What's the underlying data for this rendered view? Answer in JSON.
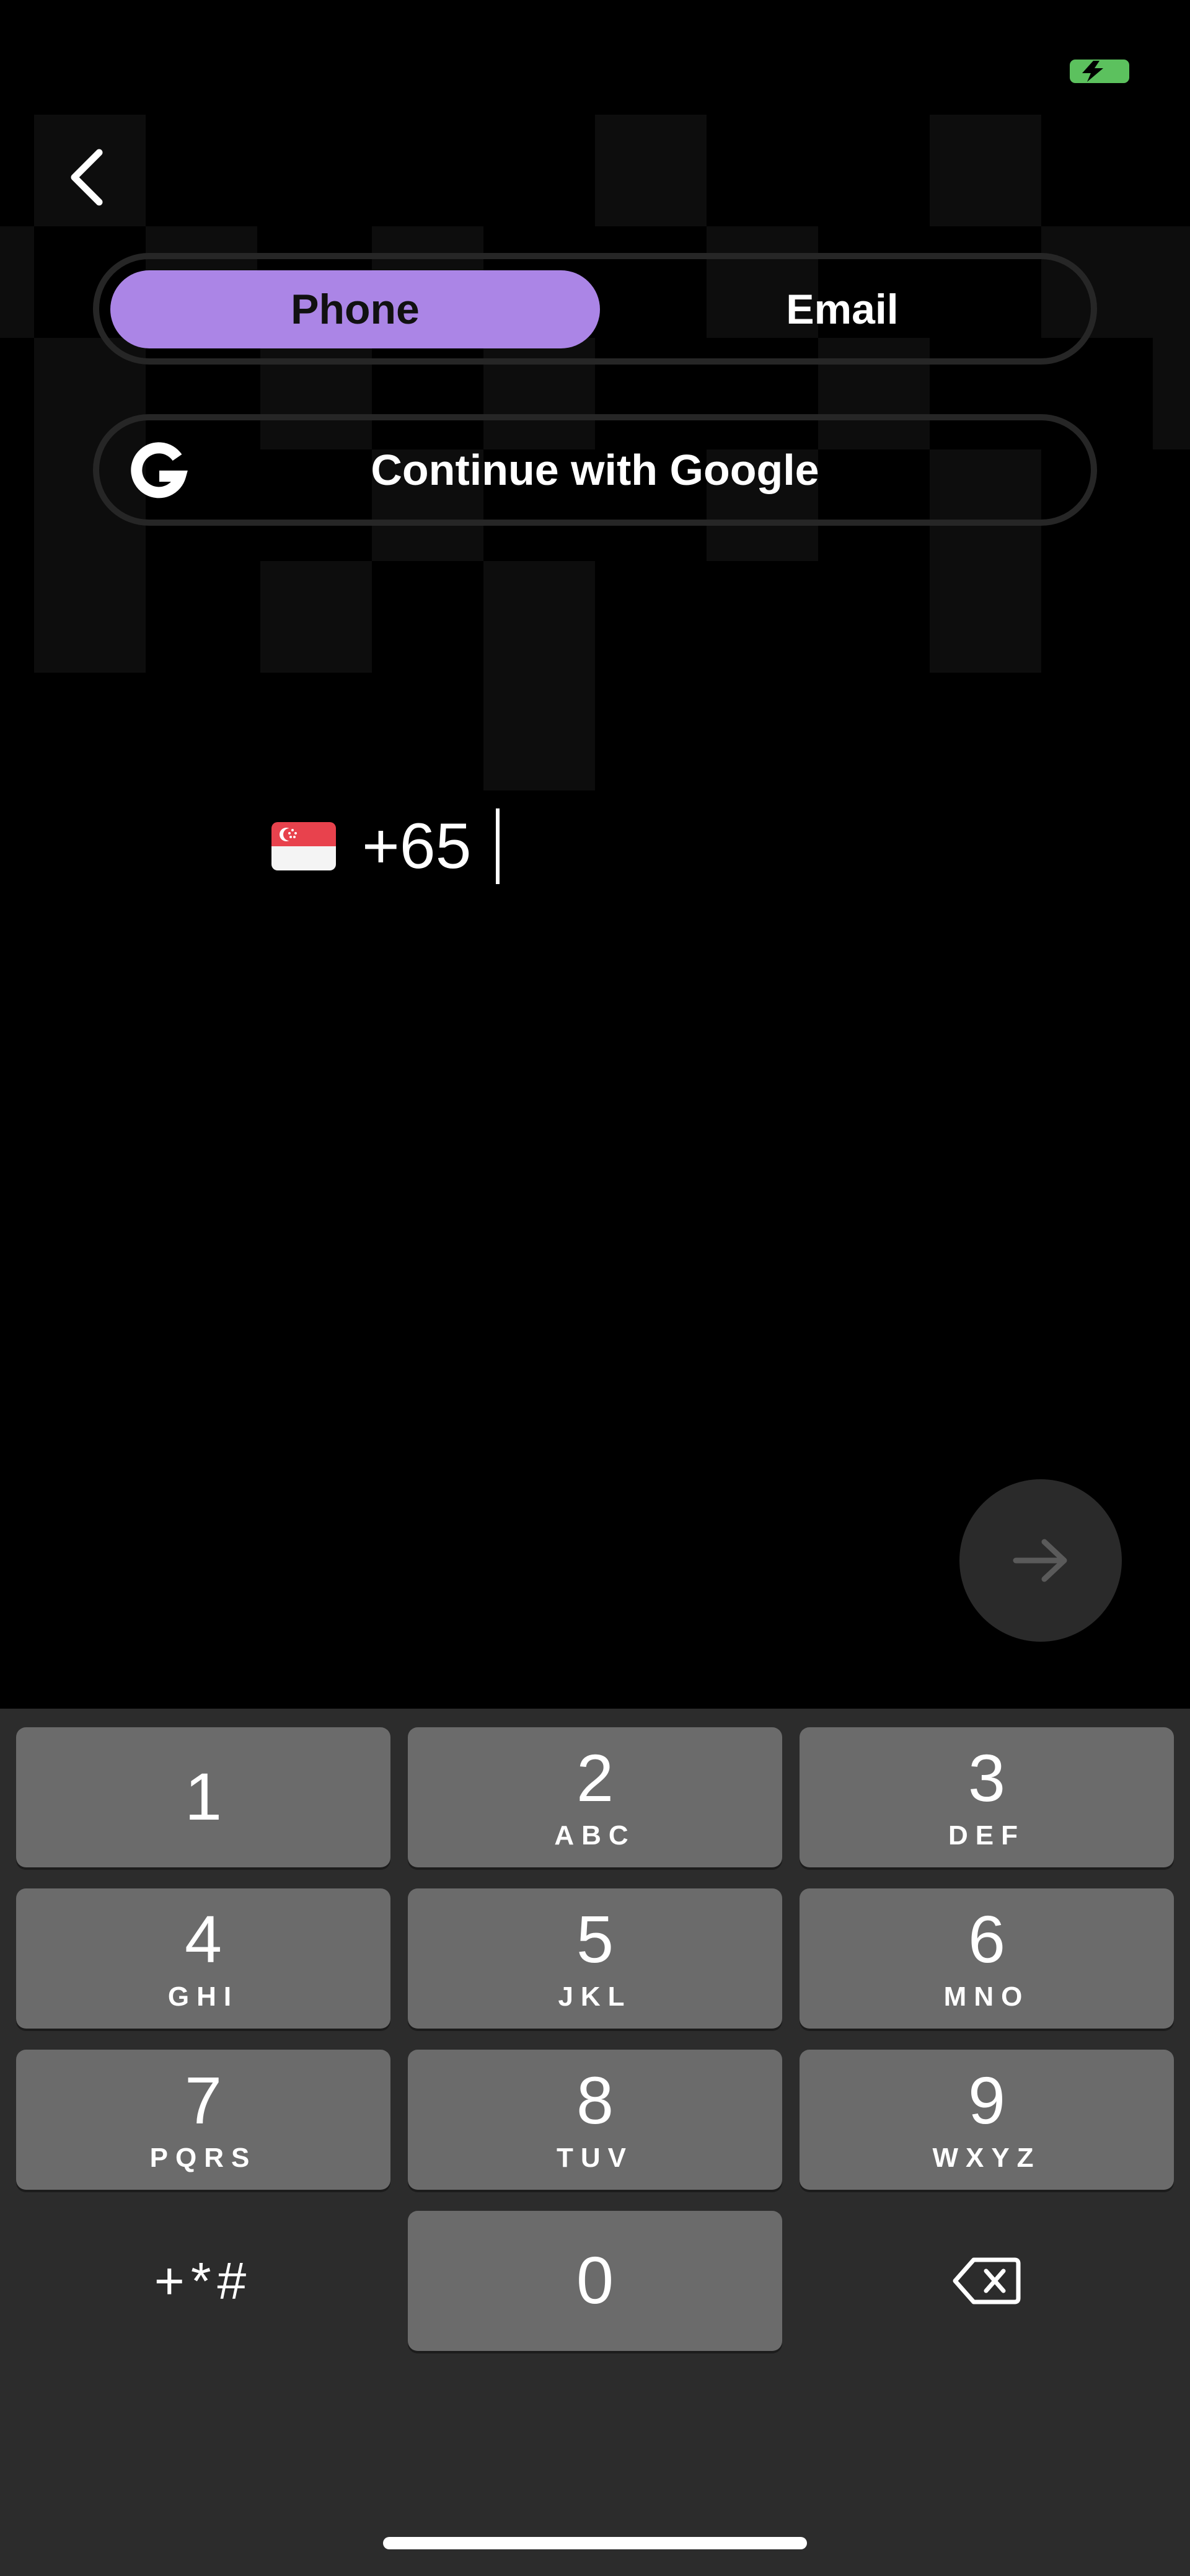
{
  "auth_tabs": {
    "phone": "Phone",
    "email": "Email",
    "selected": "Phone"
  },
  "google_button": {
    "label": "Continue with Google",
    "icon": "google-g-icon"
  },
  "phone": {
    "country": "Singapore",
    "flag_icon": "singapore-flag-icon",
    "value": "+65"
  },
  "next_button": {
    "icon": "arrow-right-icon"
  },
  "keypad": {
    "keys": [
      {
        "num": "1",
        "letters": ""
      },
      {
        "num": "2",
        "letters": "ABC"
      },
      {
        "num": "3",
        "letters": "DEF"
      },
      {
        "num": "4",
        "letters": "GHI"
      },
      {
        "num": "5",
        "letters": "JKL"
      },
      {
        "num": "6",
        "letters": "MNO"
      },
      {
        "num": "7",
        "letters": "PQRS"
      },
      {
        "num": "8",
        "letters": "TUV"
      },
      {
        "num": "9",
        "letters": "WXYZ"
      },
      {
        "num": "0",
        "letters": ""
      }
    ],
    "symbols_label": "+*#",
    "delete_icon": "backspace-icon"
  },
  "colors": {
    "accent": "#ab85e6",
    "battery": "#5cc15e",
    "key": "#6b6b6b",
    "keyboard_bg": "#2c2c2c"
  }
}
